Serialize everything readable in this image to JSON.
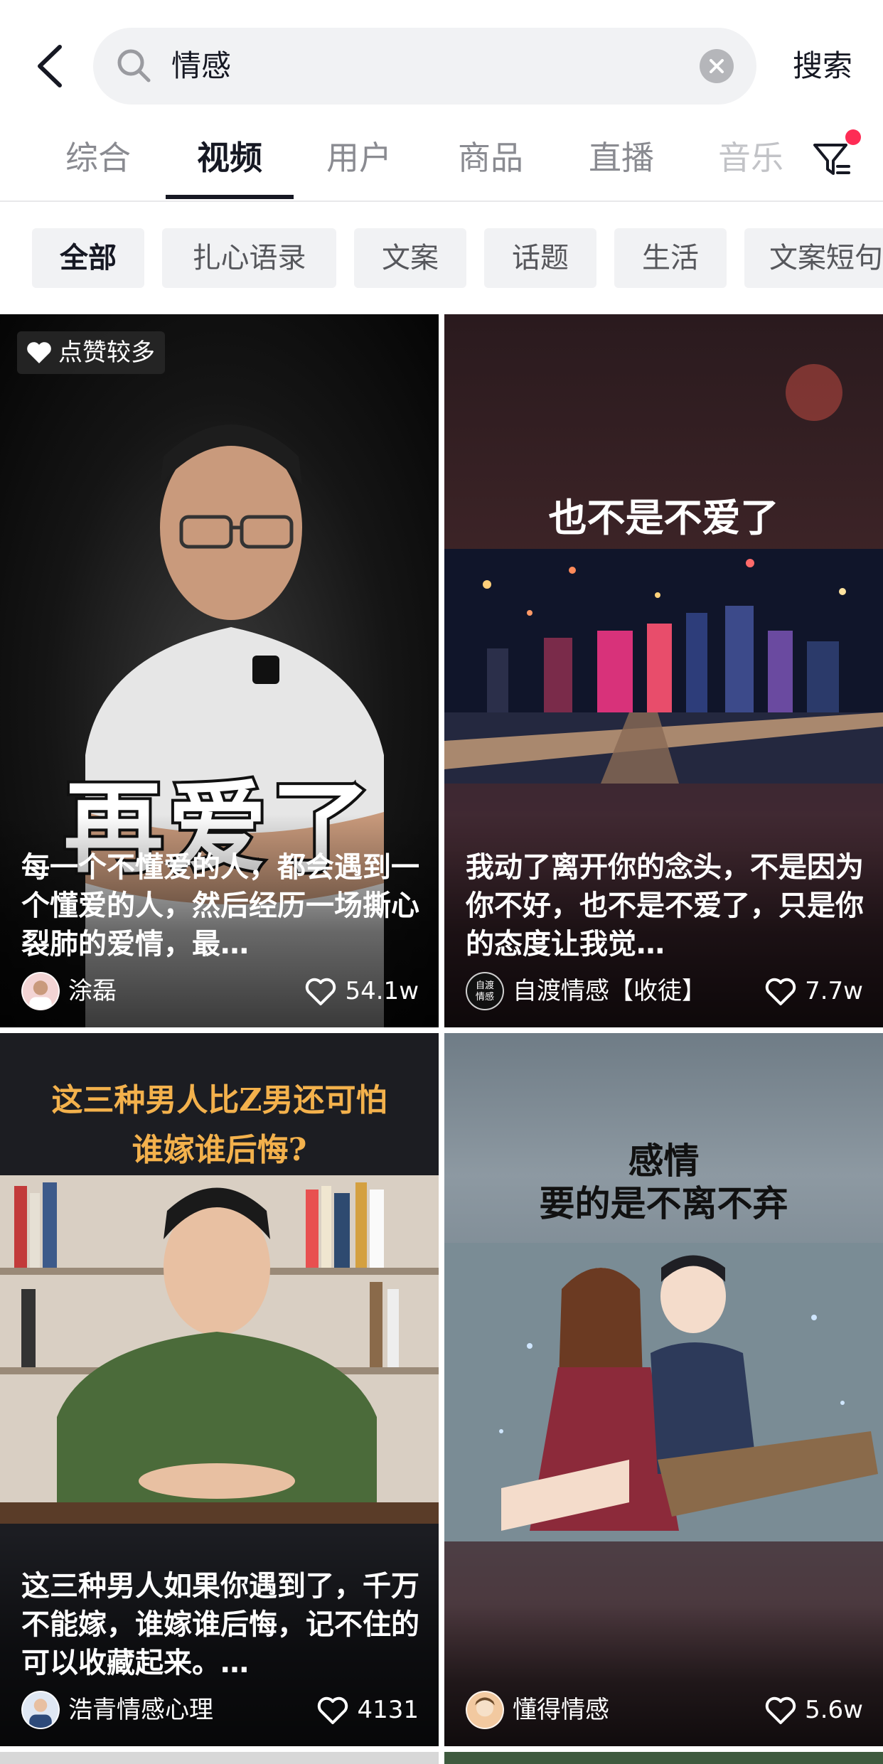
{
  "search": {
    "query": "情感",
    "submit_label": "搜索"
  },
  "tabs": [
    {
      "label": "综合"
    },
    {
      "label": "视频"
    },
    {
      "label": "用户"
    },
    {
      "label": "商品"
    },
    {
      "label": "直播"
    },
    {
      "label": "音乐"
    }
  ],
  "chips": [
    {
      "label": "全部"
    },
    {
      "label": "扎心语录"
    },
    {
      "label": "文案"
    },
    {
      "label": "话题"
    },
    {
      "label": "生活"
    },
    {
      "label": "文案短句"
    }
  ],
  "colors": {
    "accent": "#fe2c55",
    "text": "#161823",
    "muted": "#8a8b91",
    "chip_bg": "#f1f2f4"
  },
  "videos": [
    {
      "badge": "点赞较多",
      "overlay_text": "再爱了",
      "description": "每一个不懂爱的人，都会遇到一个懂爱的人，然后经历一场撕心裂肺的爱情，最…",
      "author": "涂磊",
      "likes": "54.1w"
    },
    {
      "overlay_text": "也不是不爱了",
      "description": "我动了离开你的念头，不是因为你不好，也不是不爱了，只是你的态度让我觉…",
      "author": "自渡情感【收徒】",
      "avatar_text": "自渡情感",
      "likes": "7.7w"
    },
    {
      "overlay_text_line1": "这三种男人比Z男还可怕",
      "overlay_text_line2": "谁嫁谁后悔?",
      "description": "这三种男人如果你遇到了，千万不能嫁，谁嫁谁后悔，记不住的可以收藏起来。…",
      "author": "浩青情感心理",
      "likes": "4131"
    },
    {
      "overlay_text_line1": "感情",
      "overlay_text_line2": "要的是不离不弃",
      "author": "懂得情感",
      "likes": "5.6w"
    }
  ]
}
